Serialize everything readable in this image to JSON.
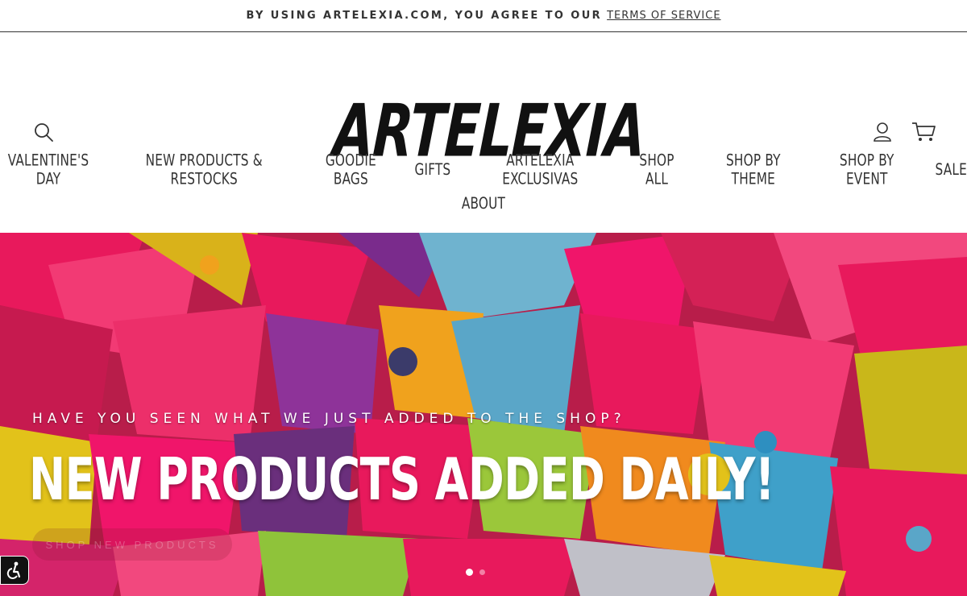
{
  "announcement": {
    "text": "BY USING ARTELEXIA.COM, YOU AGREE TO OUR",
    "link": "TERMS OF SERVICE"
  },
  "header": {
    "logo_text": "ARTELEXIA",
    "icons": [
      "search-icon",
      "account-icon",
      "cart-icon"
    ]
  },
  "nav": {
    "row1": [
      "VALENTINE'S DAY",
      "NEW PRODUCTS & RESTOCKS",
      "GOODIE BAGS",
      "GIFTS",
      "ARTELEXIA EXCLUSIVAS",
      "SHOP ALL",
      "SHOP BY THEME",
      "SHOP BY EVENT",
      "SALE"
    ],
    "row2": [
      "ABOUT"
    ]
  },
  "hero": {
    "subtitle": "HAVE YOU SEEN WHAT WE JUST ADDED TO THE SHOP?",
    "title": "NEW PRODUCTS ADDED DAILY!",
    "button": "SHOP NEW PRODUCTS",
    "slides": 2,
    "active_slide": 1
  },
  "colors": {
    "text": "#333333",
    "hero_pink": "#e8195c",
    "hero_blue": "#5aa6c8",
    "hero_yellow": "#e2c21a",
    "hero_orange": "#f08a1e"
  }
}
